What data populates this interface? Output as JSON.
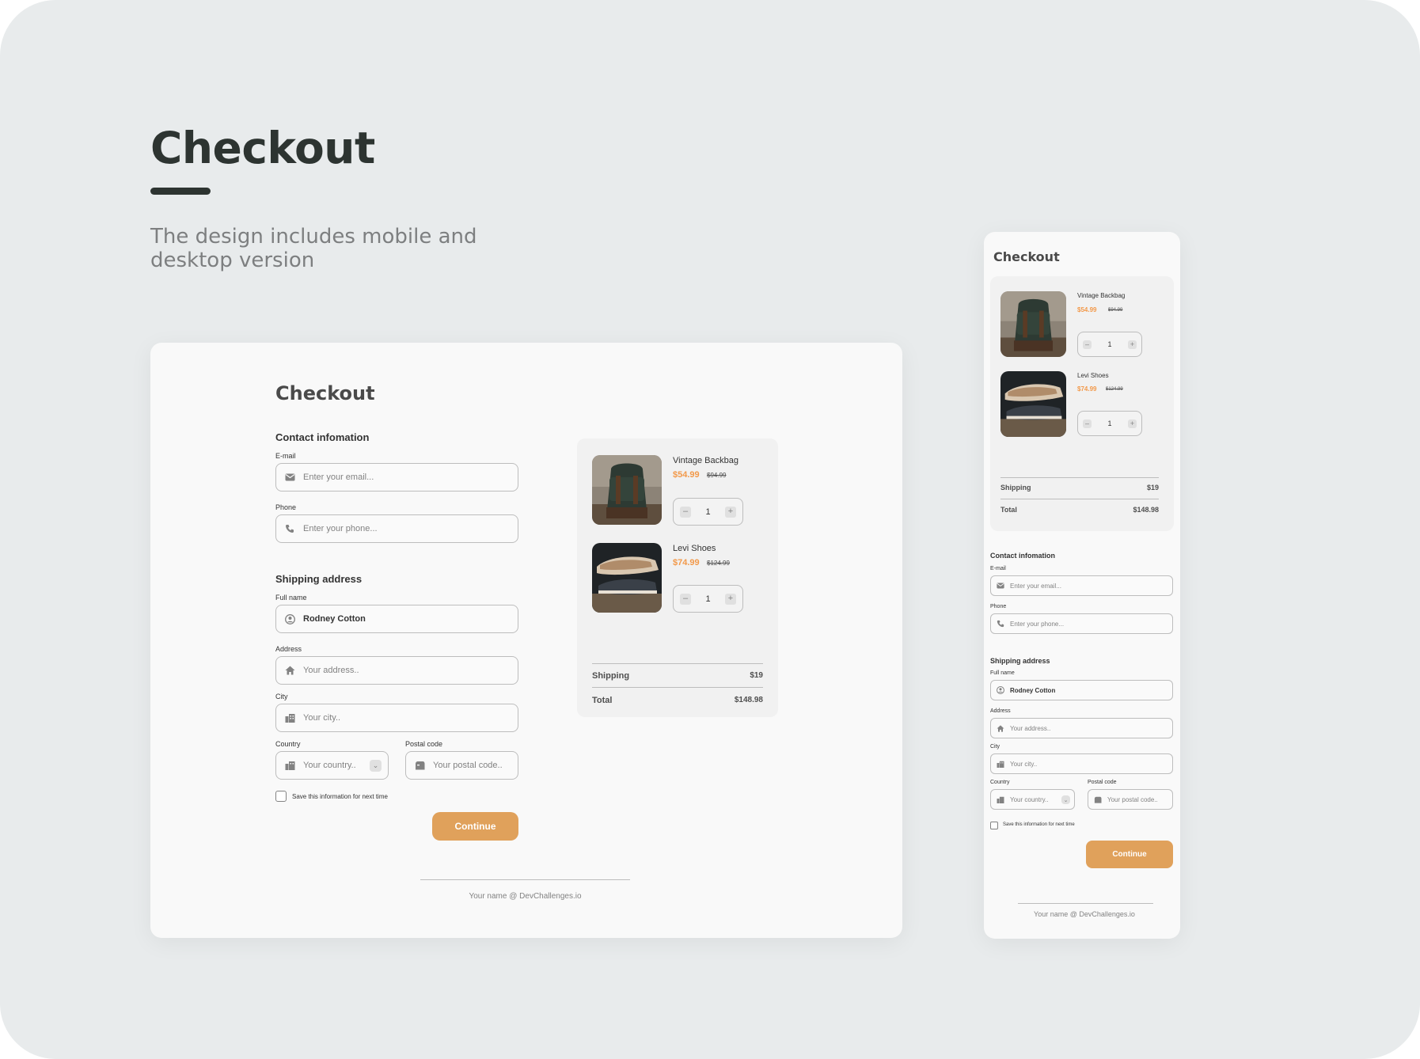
{
  "hero": {
    "title": "Checkout",
    "subtitle": "The design includes mobile and desktop version"
  },
  "checkout": {
    "title": "Checkout",
    "contact_heading": "Contact infomation",
    "email_label": "E-mail",
    "email_placeholder": "Enter your email...",
    "phone_label": "Phone",
    "phone_placeholder": "Enter your phone...",
    "shipping_heading": "Shipping address",
    "fullname_label": "Full name",
    "fullname_value": "Rodney Cotton",
    "address_label": "Address",
    "address_placeholder": "Your address..",
    "city_label": "City",
    "city_placeholder": "Your city..",
    "country_label": "Country",
    "country_placeholder": "Your country..",
    "postal_label": "Postal code",
    "postal_placeholder": "Your postal code..",
    "save_label": "Save this information for next time",
    "continue_label": "Continue",
    "footer": "Your name @ DevChallenges.io"
  },
  "cart": {
    "items": [
      {
        "name": "Vintage Backbag",
        "price": "$54.99",
        "old_price": "$94.99",
        "qty": "1"
      },
      {
        "name": "Levi Shoes",
        "price": "$74.99",
        "old_price": "$124.99",
        "qty": "1"
      }
    ],
    "shipping_label": "Shipping",
    "shipping_value": "$19",
    "total_label": "Total",
    "total_value": "$148.98"
  },
  "colors": {
    "accent": "#F2994A",
    "button": "#E0A15B",
    "background": "#E8EBEC",
    "card": "#F9F9F9"
  },
  "icons": {
    "email": "mail-icon",
    "phone": "phone-icon",
    "fullname": "user-circle-icon",
    "address": "home-icon",
    "city": "city-icon",
    "country": "flag-icon",
    "postal": "mailbox-icon",
    "dropdown": "chevron-down-icon"
  }
}
